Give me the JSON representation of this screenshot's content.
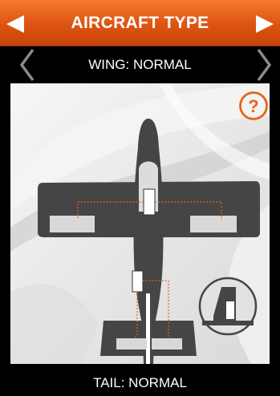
{
  "header": {
    "title": "AIRCRAFT TYPE",
    "prev_icon": "triangle-left-icon",
    "next_icon": "triangle-right-icon"
  },
  "wing_selector": {
    "label": "WING: NORMAL",
    "prev_icon": "chevron-left-icon",
    "next_icon": "chevron-right-icon"
  },
  "help": {
    "icon": "question-mark-icon"
  },
  "tail_selector": {
    "label": "TAIL: NORMAL"
  },
  "colors": {
    "accent": "#e8621c",
    "aircraft": "#454545",
    "surface": "#d8d8d8",
    "servo": "#ffffff"
  }
}
